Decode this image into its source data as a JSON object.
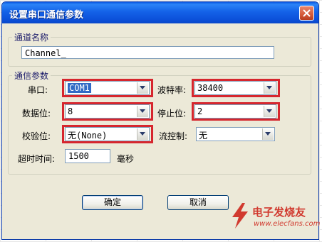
{
  "dialog": {
    "title": "设置串口通信参数"
  },
  "channel_group": {
    "legend": "通道名称",
    "name_value": "Channel_"
  },
  "comm_group": {
    "legend": "通信参数",
    "port_label": "串口:",
    "port_value": "COM1",
    "baud_label": "波特率:",
    "baud_value": "38400",
    "databits_label": "数据位:",
    "databits_value": "8",
    "stopbits_label": "停止位:",
    "stopbits_value": "2",
    "parity_label": "校验位:",
    "parity_value": "无(None)",
    "flow_label": "流控制:",
    "flow_value": "无",
    "timeout_label": "超时时间:",
    "timeout_value": "1500",
    "timeout_unit": "毫秒"
  },
  "buttons": {
    "ok": "确定",
    "cancel": "取消"
  },
  "watermark": {
    "text1": "电子发烧友",
    "text2": "www.elecfans.com"
  },
  "colors": {
    "highlight": "#d6262e",
    "titlebar": "#0b4fd8"
  }
}
